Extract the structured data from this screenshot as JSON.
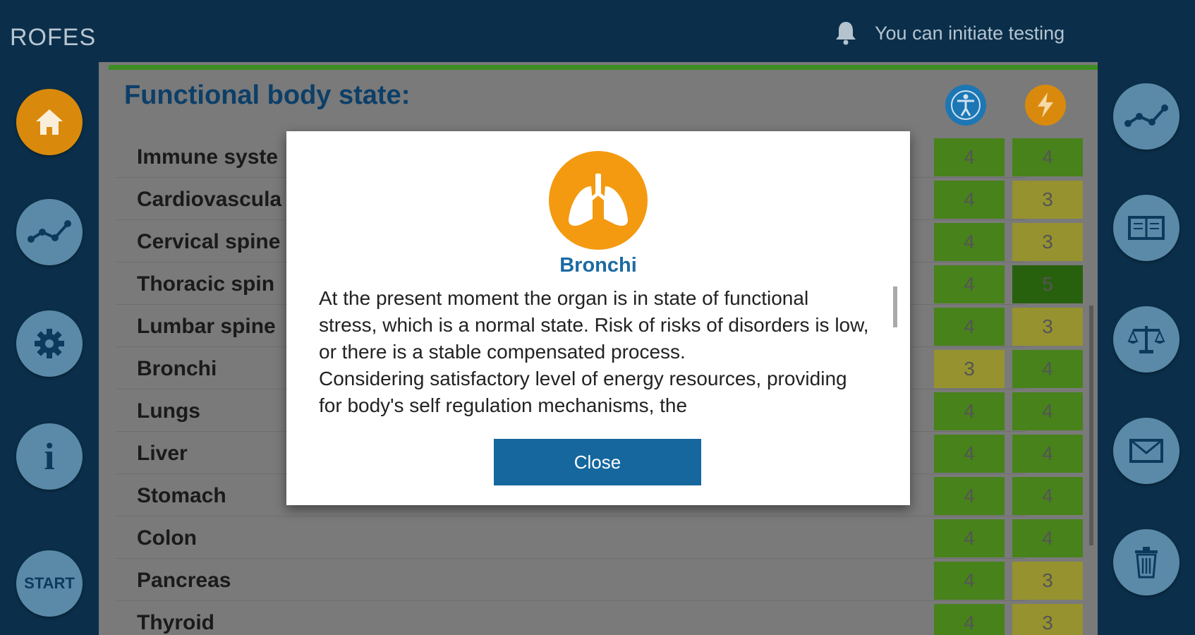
{
  "app": {
    "logo": "ROFES",
    "status_text": "You can initiate testing"
  },
  "left_nav": {
    "items": [
      {
        "name": "home",
        "icon": "home-icon"
      },
      {
        "name": "graph",
        "icon": "graph-icon"
      },
      {
        "name": "settings",
        "icon": "gear-icon"
      },
      {
        "name": "info",
        "icon": "info-icon",
        "label": "i"
      },
      {
        "name": "start",
        "icon": "start-button",
        "label": "START"
      }
    ]
  },
  "right_nav": {
    "items": [
      {
        "name": "graph",
        "icon": "graph-icon"
      },
      {
        "name": "book",
        "icon": "book-icon"
      },
      {
        "name": "scale",
        "icon": "scale-icon"
      },
      {
        "name": "mail",
        "icon": "mail-icon"
      },
      {
        "name": "trash",
        "icon": "trash-icon"
      }
    ]
  },
  "panel": {
    "title": "Functional body state:",
    "column_icons": [
      "person-icon",
      "lightning-icon"
    ],
    "rows": [
      {
        "label": "Immune syste",
        "body": "4",
        "energy": "4"
      },
      {
        "label": "Cardiovascula",
        "body": "4",
        "energy": "3"
      },
      {
        "label": "Cervical spine",
        "body": "4",
        "energy": "3"
      },
      {
        "label": "Thoracic spin",
        "body": "4",
        "energy": "5"
      },
      {
        "label": "Lumbar spine",
        "body": "4",
        "energy": "3"
      },
      {
        "label": "Bronchi",
        "body": "3",
        "energy": "4"
      },
      {
        "label": "Lungs",
        "body": "4",
        "energy": "4"
      },
      {
        "label": "Liver",
        "body": "4",
        "energy": "4"
      },
      {
        "label": "Stomach",
        "body": "4",
        "energy": "4"
      },
      {
        "label": "Colon",
        "body": "4",
        "energy": "4"
      },
      {
        "label": "Pancreas",
        "body": "4",
        "energy": "3"
      },
      {
        "label": "Thyroid",
        "body": "4",
        "energy": "3"
      }
    ]
  },
  "modal": {
    "icon": "lungs-icon",
    "title": "Bronchi",
    "paragraphs": [
      "At the present moment the organ is in state of functional stress, which is a normal state. Risk of risks of disorders is low, or there is a stable compensated process.",
      "Considering satisfactory level of energy resources, providing for body's self regulation mechanisms, the"
    ],
    "close_label": "Close"
  },
  "colors": {
    "background": "#0b2f4a",
    "accent_orange": "#f39a10",
    "accent_blue": "#15679d",
    "score_3": "#96922f",
    "score_4": "#47821b",
    "score_5": "#28610e"
  }
}
